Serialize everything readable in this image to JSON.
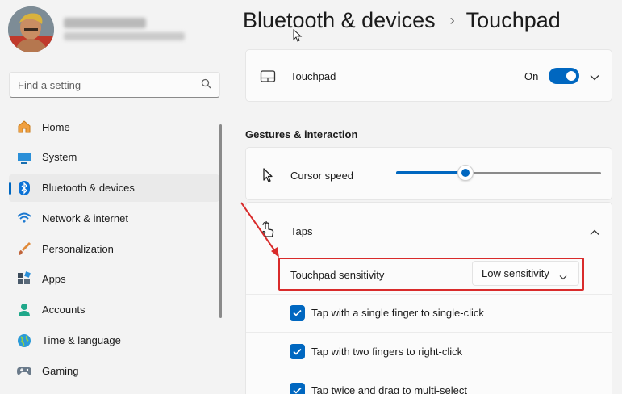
{
  "sidebar": {
    "search_placeholder": "Find a setting",
    "items": [
      {
        "label": "Home",
        "icon": "home-icon"
      },
      {
        "label": "System",
        "icon": "system-icon"
      },
      {
        "label": "Bluetooth & devices",
        "icon": "bluetooth-icon",
        "active": true
      },
      {
        "label": "Network & internet",
        "icon": "wifi-icon"
      },
      {
        "label": "Personalization",
        "icon": "brush-icon"
      },
      {
        "label": "Apps",
        "icon": "apps-icon"
      },
      {
        "label": "Accounts",
        "icon": "person-icon"
      },
      {
        "label": "Time & language",
        "icon": "globe-icon"
      },
      {
        "label": "Gaming",
        "icon": "gamepad-icon"
      }
    ]
  },
  "header": {
    "breadcrumb_parent": "Bluetooth & devices",
    "breadcrumb_separator": "›",
    "breadcrumb_current": "Touchpad"
  },
  "touchpad_card": {
    "label": "Touchpad",
    "state_label": "On",
    "enabled": true
  },
  "gestures": {
    "section_title": "Gestures & interaction",
    "cursor_speed_label": "Cursor speed",
    "cursor_speed_fraction": 0.34,
    "taps_label": "Taps",
    "sensitivity_label": "Touchpad sensitivity",
    "sensitivity_value": "Low sensitivity",
    "checkboxes": [
      {
        "label": "Tap with a single finger to single-click",
        "checked": true
      },
      {
        "label": "Tap with two fingers to right-click",
        "checked": true
      },
      {
        "label": "Tap twice and drag to multi-select",
        "checked": true
      }
    ]
  },
  "colors": {
    "accent": "#0067c0",
    "annotation": "#d92b2b"
  }
}
